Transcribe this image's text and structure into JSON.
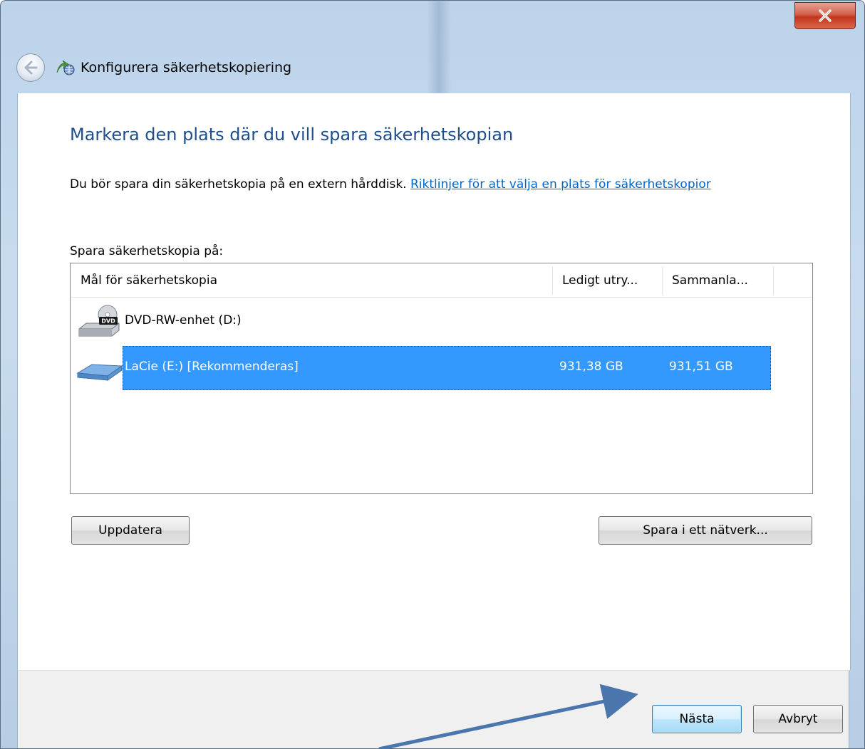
{
  "window": {
    "title": "Konfigurera säkerhetskopiering",
    "close_label": "X"
  },
  "main": {
    "heading": "Markera den plats där du vill spara säkerhetskopian",
    "intro_text": "Du bör spara din säkerhetskopia på en extern hårddisk.",
    "intro_link": "Riktlinjer för att välja en plats för säkerhetskopior",
    "save_label": "Spara säkerhetskopia på:"
  },
  "destinations": {
    "columns": [
      "Mål för säkerhetskopia",
      "Ledigt utry...",
      "Sammanla..."
    ],
    "rows": [
      {
        "name": "DVD-RW-enhet (D:)",
        "free": "",
        "total": "",
        "icon": "dvd-drive-icon",
        "selected": false
      },
      {
        "name": "LaCie (E:) [Rekommenderas]",
        "free": "931,38 GB",
        "total": "931,51 GB",
        "icon": "external-drive-icon",
        "selected": true
      }
    ]
  },
  "buttons": {
    "refresh": "Uppdatera",
    "save_network": "Spara i ett nätverk...",
    "next": "Nästa",
    "cancel": "Avbryt"
  },
  "colors": {
    "heading": "#1e4e8c",
    "link": "#0066cc",
    "selection": "#3399ff",
    "annotation_arrow": "#4a76ad"
  }
}
